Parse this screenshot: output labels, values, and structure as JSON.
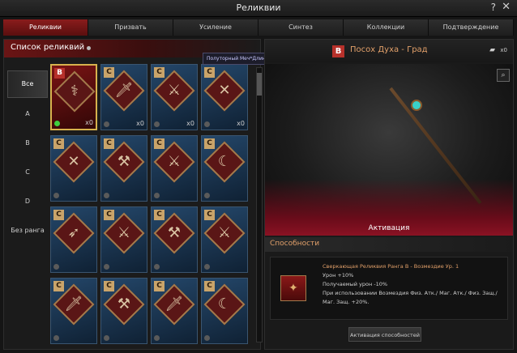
{
  "window": {
    "title": "Реликвии",
    "help": "?",
    "close": "✕"
  },
  "tabs": [
    {
      "label": "Реликвии",
      "active": true
    },
    {
      "label": "Призвать",
      "active": false
    },
    {
      "label": "Усиление",
      "active": false
    },
    {
      "label": "Синтез",
      "active": false
    },
    {
      "label": "Коллекции",
      "active": false
    },
    {
      "label": "Подтверждение",
      "active": false
    }
  ],
  "list": {
    "header": "Список реликвий",
    "filters": [
      "Все",
      "A",
      "B",
      "C",
      "D",
      "Без ранга"
    ],
    "tooltip": "Полуторный Меч*Длинный Меч Эльфов",
    "cards": [
      {
        "grade": "B",
        "count": "x0",
        "icon": "⚕",
        "selected": true
      },
      {
        "grade": "C",
        "count": "x0",
        "icon": "🗡",
        "selected": false
      },
      {
        "grade": "C",
        "count": "x0",
        "icon": "⚔",
        "selected": false
      },
      {
        "grade": "C",
        "count": "x0",
        "icon": "✕",
        "selected": false
      },
      {
        "grade": "C",
        "count": "",
        "icon": "✕",
        "selected": false
      },
      {
        "grade": "C",
        "count": "",
        "icon": "⚒",
        "selected": false
      },
      {
        "grade": "C",
        "count": "",
        "icon": "⚔",
        "selected": false
      },
      {
        "grade": "C",
        "count": "",
        "icon": "☾",
        "selected": false
      },
      {
        "grade": "C",
        "count": "",
        "icon": "➶",
        "selected": false
      },
      {
        "grade": "C",
        "count": "",
        "icon": "⚔",
        "selected": false
      },
      {
        "grade": "C",
        "count": "",
        "icon": "⚒",
        "selected": false
      },
      {
        "grade": "C",
        "count": "",
        "icon": "⚔",
        "selected": false
      },
      {
        "grade": "C",
        "count": "",
        "icon": "🗡",
        "selected": false
      },
      {
        "grade": "C",
        "count": "",
        "icon": "⚒",
        "selected": false
      },
      {
        "grade": "C",
        "count": "",
        "icon": "🗡",
        "selected": false
      },
      {
        "grade": "C",
        "count": "",
        "icon": "☾",
        "selected": false
      }
    ]
  },
  "detail": {
    "grade": "B",
    "name": "Посох Духа - Град",
    "folder_icon": "folder-icon",
    "folder_count": "x0",
    "activation": "Активация",
    "abilities_title": "Способности",
    "ability": {
      "title": "Сверкающая Реликвия Ранга B - Возмездие Ур. 1",
      "lines": [
        "Урон +10%",
        "Получаемый урон -10%",
        "При использовании Возмездия Физ. Атк./ Маг. Атк./ Физ. Защ./ Маг. Защ. +20%."
      ]
    },
    "activate_button": "Активация способностей"
  }
}
